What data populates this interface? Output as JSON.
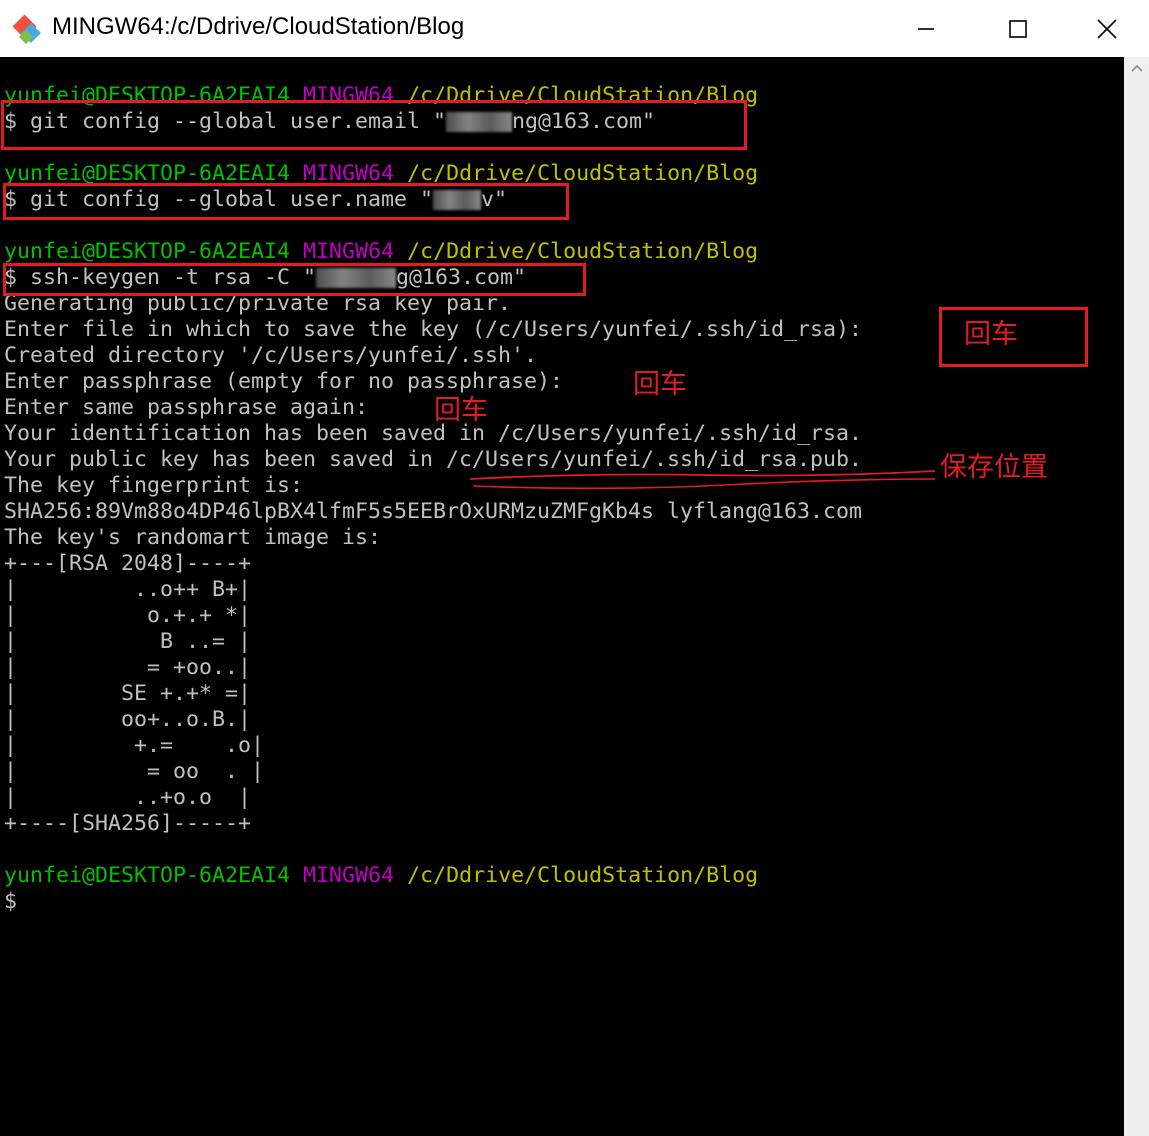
{
  "window": {
    "title": "MINGW64:/c/Ddrive/CloudStation/Blog"
  },
  "prompt": {
    "user": "yunfei@DESKTOP-6A2EAI4",
    "system": "MINGW64",
    "path": "/c/Ddrive/CloudStation/Blog"
  },
  "commands": {
    "email_prefix": "$ git config --global user.email \"",
    "email_suffix": "ng@163.com\"",
    "name_prefix": "$ git config --global user.name \"",
    "name_suffix": "v\"",
    "keygen_prefix": "$ ssh-keygen -t rsa -C \"",
    "keygen_suffix": "g@163.com\""
  },
  "output": [
    "Generating public/private rsa key pair.",
    "Enter file in which to save the key (/c/Users/yunfei/.ssh/id_rsa):",
    "Created directory '/c/Users/yunfei/.ssh'.",
    "Enter passphrase (empty for no passphrase):",
    "Enter same passphrase again:",
    "Your identification has been saved in /c/Users/yunfei/.ssh/id_rsa.",
    "Your public key has been saved in /c/Users/yunfei/.ssh/id_rsa.pub.",
    "The key fingerprint is:",
    "SHA256:89Vm88o4DP46lpBX4lfmF5s5EEBrOxURMzuZMFgKb4s lyflang@163.com",
    "The key's randomart image is:",
    "+---[RSA 2048]----+",
    "|         ..o++ B+|",
    "|          o.+.+ *|",
    "|           B ..= |",
    "|          = +oo..|",
    "|        SE +.+* =|",
    "|        oo+..o.B.|",
    "|         +.=    .o|",
    "|          = oo  . |",
    "|         ..+o.o  |",
    "+----[SHA256]-----+"
  ],
  "final_prompt": "$",
  "annotations": {
    "enter_1": "回车",
    "enter_2": "回车",
    "enter_3": "回车",
    "save_location": "保存位置"
  },
  "colors": {
    "user": "#00c000",
    "system": "#c000c0",
    "path": "#c0c000",
    "annotation": "#e31b23"
  }
}
